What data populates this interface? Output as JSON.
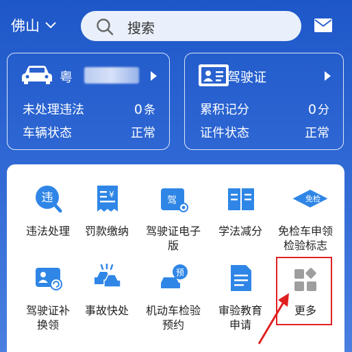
{
  "header": {
    "city": "佛山",
    "search_placeholder": "搜索"
  },
  "vehicle_card": {
    "plate_prefix": "粤",
    "rows": [
      {
        "label": "未处理违法",
        "value": "0",
        "unit": "条"
      },
      {
        "label": "车辆状态",
        "value": "正常",
        "unit": ""
      }
    ]
  },
  "license_card": {
    "title": "驾驶证",
    "rows": [
      {
        "label": "累积记分",
        "value": "0",
        "unit": "分"
      },
      {
        "label": "证件状态",
        "value": "正常",
        "unit": ""
      }
    ]
  },
  "services": [
    {
      "label": "违法处理",
      "icon": "violation-icon",
      "badge": "违"
    },
    {
      "label": "罚款缴纳",
      "icon": "fine-receipt-icon",
      "badge": "¥"
    },
    {
      "label": "驾驶证电子版",
      "icon": "e-license-icon",
      "badge": "驾"
    },
    {
      "label": "学法减分",
      "icon": "book-icon"
    },
    {
      "label": "免检车申领检验标志",
      "icon": "inspection-exempt-icon",
      "badge": "免检"
    },
    {
      "label": "驾驶证补换领",
      "icon": "license-renew-icon"
    },
    {
      "label": "事故快处",
      "icon": "accident-icon"
    },
    {
      "label": "机动车检验预约",
      "icon": "inspection-booking-icon",
      "badge": "预"
    },
    {
      "label": "审验教育申请",
      "icon": "document-icon"
    },
    {
      "label": "更多",
      "icon": "more-grid-icon"
    }
  ],
  "colors": {
    "primary": "#2a62d0",
    "icon_blue": "#2f86e6",
    "highlight": "#e02020"
  }
}
